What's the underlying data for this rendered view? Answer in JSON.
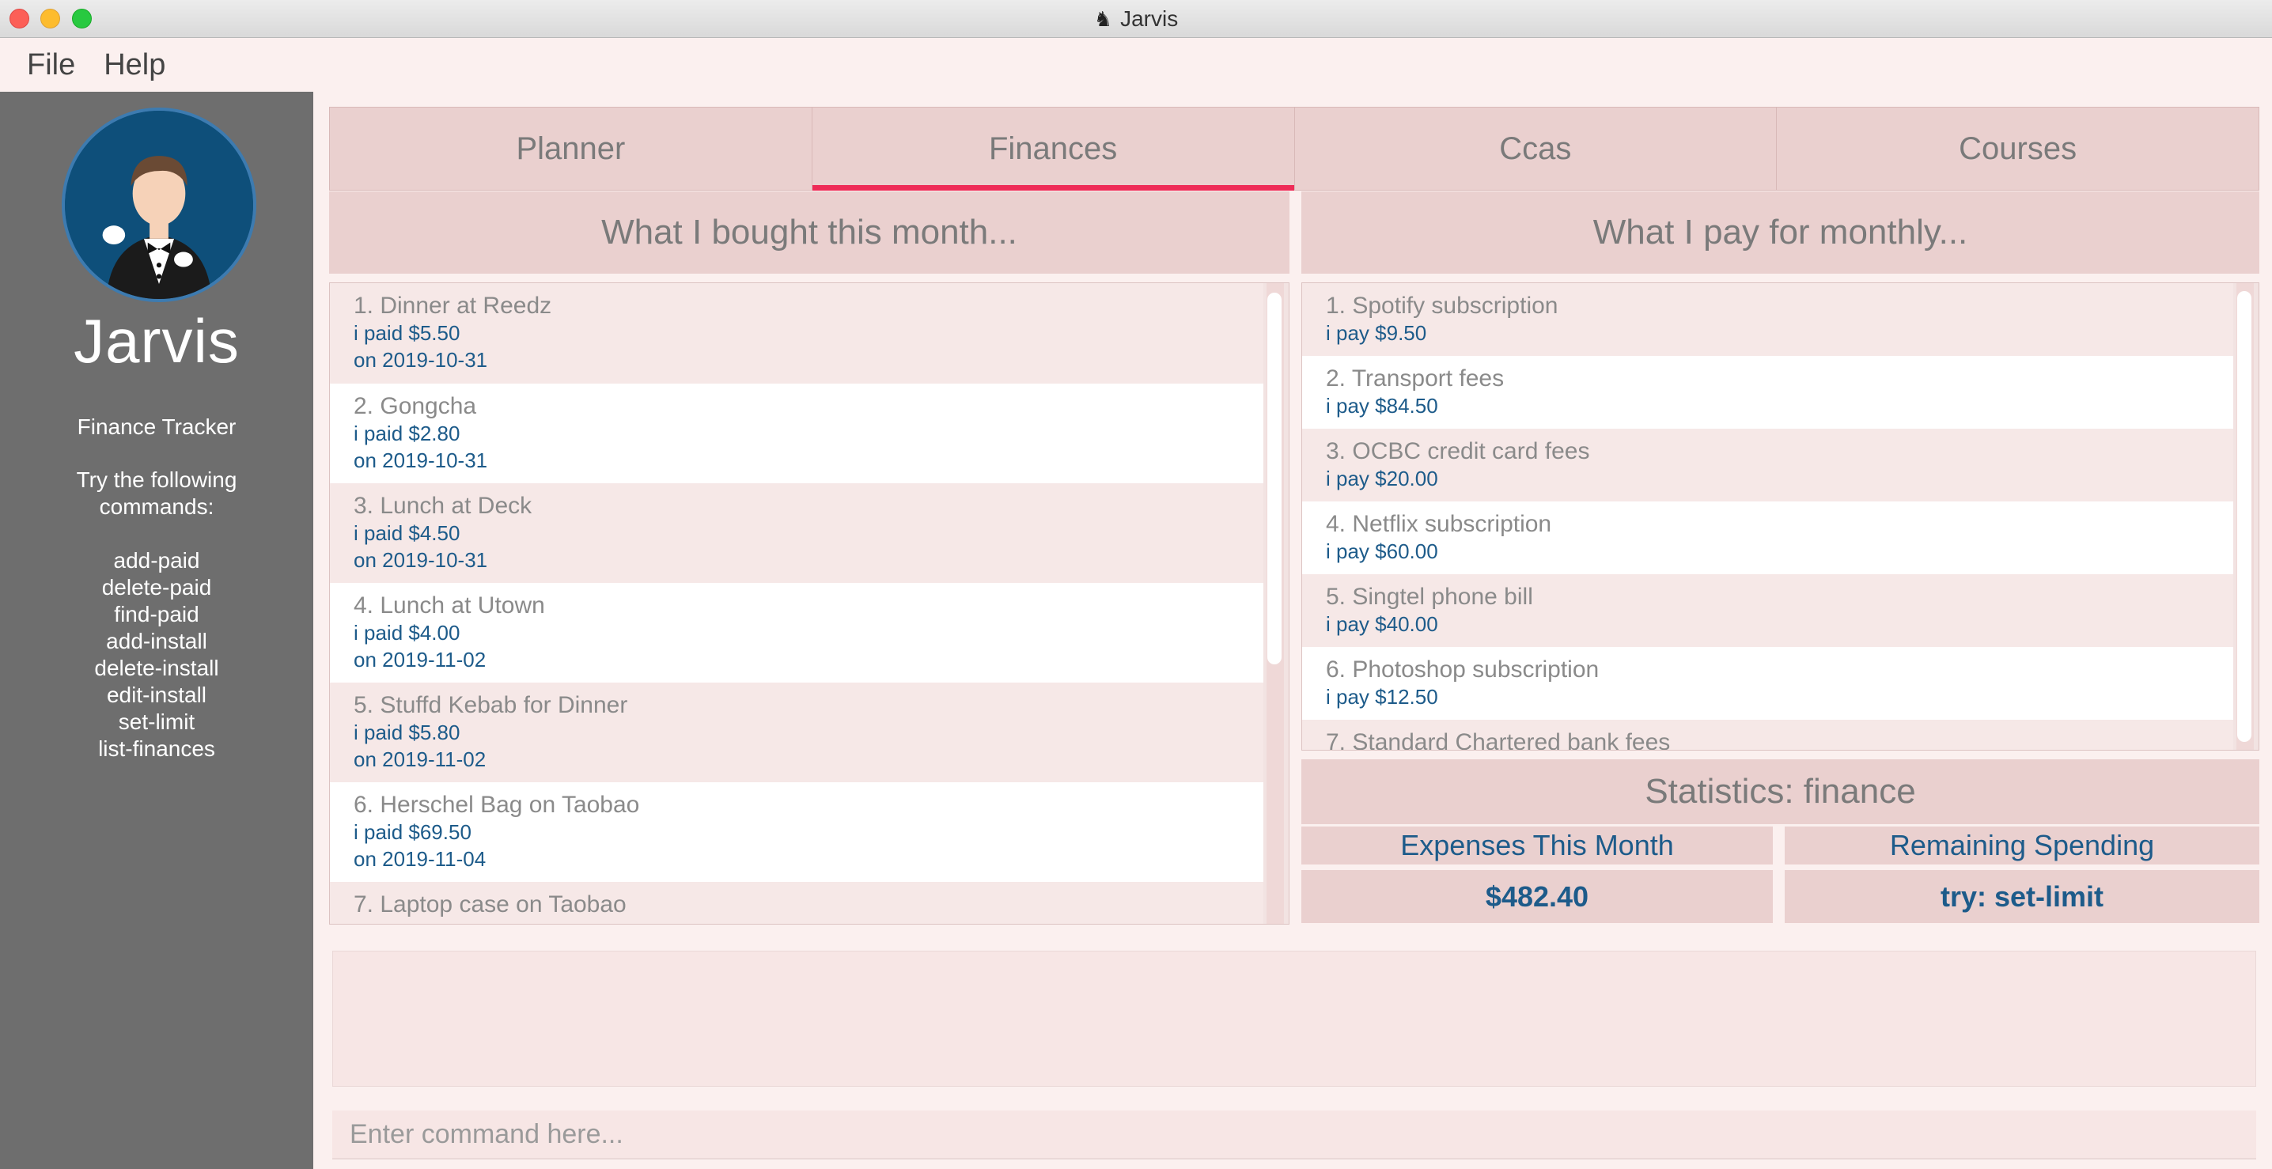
{
  "window": {
    "title": "Jarvis",
    "icon": "butler-icon"
  },
  "menu": [
    "File",
    "Help"
  ],
  "sidebar": {
    "app_name": "Jarvis",
    "mode": "Finance Tracker",
    "try_text": "Try the following commands:",
    "commands": [
      "add-paid",
      "delete-paid",
      "find-paid",
      "add-install",
      "delete-install",
      "edit-install",
      "set-limit",
      "list-finances"
    ]
  },
  "tabs": [
    {
      "label": "Planner",
      "active": false
    },
    {
      "label": "Finances",
      "active": true
    },
    {
      "label": "Ccas",
      "active": false
    },
    {
      "label": "Courses",
      "active": false
    }
  ],
  "purchases": {
    "title": "What I bought this month...",
    "items": [
      {
        "name": "1. Dinner at Reedz",
        "paid": "i paid $5.50",
        "date": "on 2019-10-31"
      },
      {
        "name": "2. Gongcha",
        "paid": "i paid $2.80",
        "date": "on 2019-10-31"
      },
      {
        "name": "3. Lunch at Deck",
        "paid": "i paid $4.50",
        "date": "on 2019-10-31"
      },
      {
        "name": "4. Lunch at Utown",
        "paid": "i paid $4.00",
        "date": "on 2019-11-02"
      },
      {
        "name": "5. Stuffd Kebab for Dinner",
        "paid": "i paid $5.80",
        "date": "on 2019-11-02"
      },
      {
        "name": "6. Herschel Bag on Taobao",
        "paid": "i paid $69.50",
        "date": "on 2019-11-04"
      },
      {
        "name": "7. Laptop case on Taobao",
        "paid": "",
        "date": ""
      }
    ]
  },
  "installments": {
    "title": "What I pay for monthly...",
    "items": [
      {
        "name": "1. Spotify subscription",
        "pay": "i pay $9.50"
      },
      {
        "name": "2. Transport fees",
        "pay": "i pay $84.50"
      },
      {
        "name": "3. OCBC credit card fees",
        "pay": "i pay $20.00"
      },
      {
        "name": "4. Netflix subscription",
        "pay": "i pay $60.00"
      },
      {
        "name": "5. Singtel phone bill",
        "pay": "i pay $40.00"
      },
      {
        "name": "6. Photoshop subscription",
        "pay": "i pay $12.50"
      },
      {
        "name": "7. Standard Chartered bank fees",
        "pay": ""
      }
    ]
  },
  "statistics": {
    "title": "Statistics: finance",
    "expenses_label": "Expenses This Month",
    "expenses_value": "$482.40",
    "remaining_label": "Remaining Spending",
    "remaining_value": "try: set-limit"
  },
  "command_box": {
    "placeholder": "Enter command here..."
  },
  "colors": {
    "accent": "#ee2b57",
    "link_blue": "#1d5b8a",
    "sidebar": "#6e6e6e",
    "panel": "#ead0cf"
  }
}
